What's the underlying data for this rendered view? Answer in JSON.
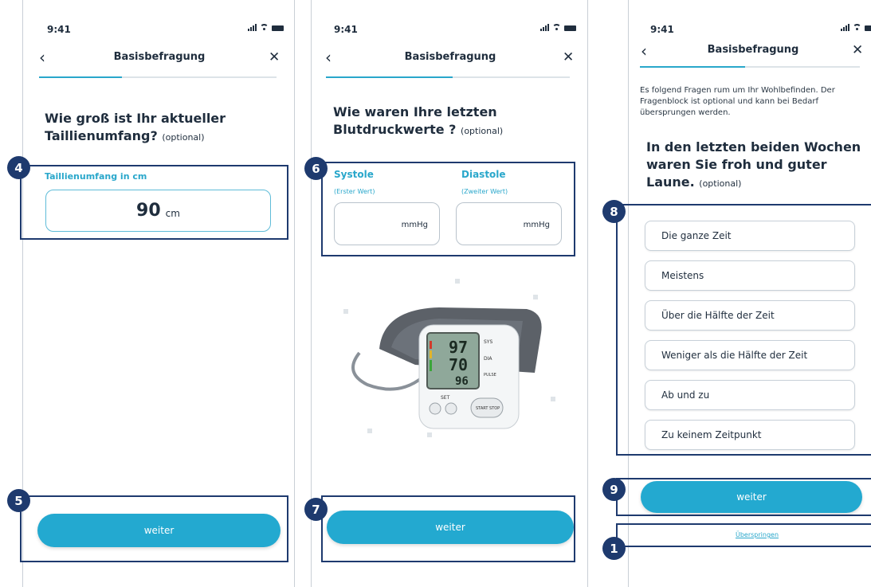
{
  "status_bar": {
    "time": "9:41"
  },
  "screens": [
    {
      "header_title": "Basisbefragung",
      "question": "Wie groß ist Ihr aktueller Taillienumfang?",
      "optional": "(optional)",
      "field_label": "Taillienumfang in cm",
      "value": "90",
      "unit": "cm",
      "button": "weiter",
      "badges": [
        "4",
        "5"
      ]
    },
    {
      "header_title": "Basisbefragung",
      "question": "Wie waren Ihre letzten Blutdruckwerte ?",
      "optional": "(optional)",
      "systole_label": "Systole",
      "systole_sub": "(Erster Wert)",
      "diastole_label": "Diastole",
      "diastole_sub": "(Zweiter Wert)",
      "unit": "mmHg",
      "monitor": {
        "sys": "97",
        "dia": "70",
        "pulse": "96",
        "sys_label": "SYS",
        "dia_label": "DIA",
        "pulse_label": "PULSE",
        "set": "SET",
        "start_stop": "START STOP"
      },
      "button": "weiter",
      "badges": [
        "6",
        "7"
      ]
    },
    {
      "header_title": "Basisbefragung",
      "intro": "Es folgend Fragen rum um Ihr Wohlbefinden. Der Fragenblock ist optional und kann bei Bedarf übersprungen werden.",
      "question": "In den letzten beiden Wochen waren Sie froh und guter Laune.",
      "optional": "(optional)",
      "options": [
        "Die ganze Zeit",
        "Meistens",
        "Über die Hälfte der Zeit",
        "Weniger als die Hälfte der Zeit",
        "Ab und zu",
        "Zu keinem Zeitpunkt"
      ],
      "button": "weiter",
      "skip": "Überspringen",
      "badges": [
        "8",
        "9",
        "1"
      ]
    }
  ],
  "progress": [
    0.35,
    0.5,
    0.48
  ],
  "colors": {
    "accent": "#23a9d0",
    "badge": "#1e3a6e",
    "text": "#1f2d3d"
  }
}
